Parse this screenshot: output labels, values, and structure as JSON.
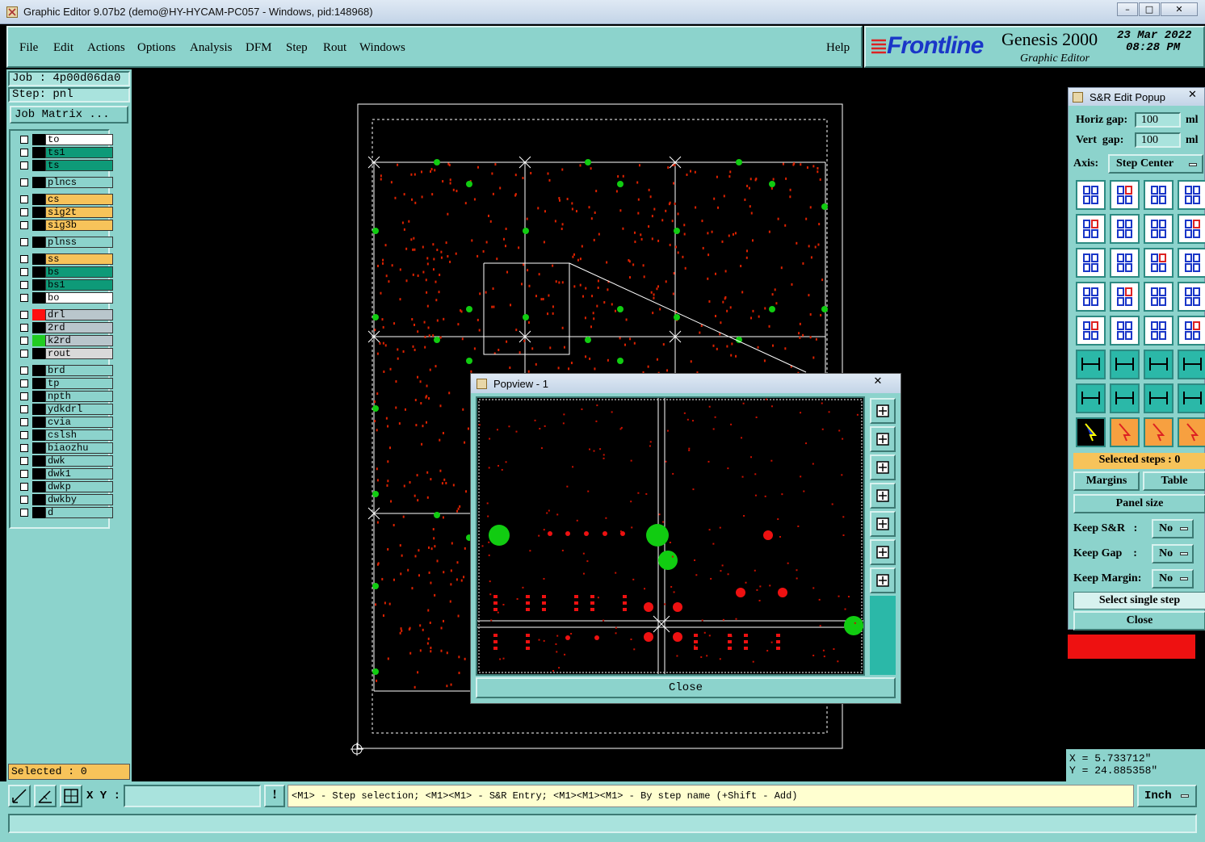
{
  "window": {
    "title": "Graphic Editor 9.07b2 (demo@HY-HYCAM-PC057 - Windows, pid:148968)"
  },
  "menu": {
    "items": [
      "File",
      "Edit",
      "Actions",
      "Options",
      "Analysis",
      "DFM",
      "Step",
      "Rout",
      "Windows"
    ],
    "help": "Help"
  },
  "logo": {
    "brand": "Frontline",
    "product": "Genesis 2000",
    "subtitle": "Graphic Editor",
    "date": "23 Mar 2022",
    "time": "08:28 PM"
  },
  "job": {
    "job_label": "Job : 4p00d06da0",
    "step_label": "Step: pnl",
    "matrix_button": "Job Matrix ..."
  },
  "layers": [
    {
      "name": "to",
      "color": "#ffffff",
      "swatch": "#000000"
    },
    {
      "name": "ts1",
      "color": "#0e9a78",
      "swatch": "#000000"
    },
    {
      "name": "ts",
      "color": "#0e9a78",
      "swatch": "#000000"
    },
    {
      "name": "plncs",
      "color": "#8cd3cc",
      "swatch": "#000000"
    },
    {
      "name": "cs",
      "color": "#f7c35a",
      "swatch": "#000000"
    },
    {
      "name": "sig2t",
      "color": "#f7c35a",
      "swatch": "#000000"
    },
    {
      "name": "sig3b",
      "color": "#f7c35a",
      "swatch": "#000000"
    },
    {
      "name": "plnss",
      "color": "#8cd3cc",
      "swatch": "#000000"
    },
    {
      "name": "ss",
      "color": "#f7c35a",
      "swatch": "#000000"
    },
    {
      "name": "bs",
      "color": "#0e9a78",
      "swatch": "#000000"
    },
    {
      "name": "bs1",
      "color": "#0e9a78",
      "swatch": "#000000"
    },
    {
      "name": "bo",
      "color": "#ffffff",
      "swatch": "#000000"
    },
    {
      "name": "drl",
      "color": "#b9c6cc",
      "swatch": "#ff1010"
    },
    {
      "name": "2rd",
      "color": "#b9c6cc",
      "swatch": "#000000"
    },
    {
      "name": "k2rd",
      "color": "#b9c6cc",
      "swatch": "#22cc22"
    },
    {
      "name": "rout",
      "color": "#d9d9d9",
      "swatch": "#000000"
    },
    {
      "name": "brd",
      "color": "#8cd3cc",
      "swatch": "#000000"
    },
    {
      "name": "tp",
      "color": "#8cd3cc",
      "swatch": "#000000"
    },
    {
      "name": "npth",
      "color": "#8cd3cc",
      "swatch": "#000000"
    },
    {
      "name": "ydkdrl",
      "color": "#8cd3cc",
      "swatch": "#000000"
    },
    {
      "name": "cvia",
      "color": "#8cd3cc",
      "swatch": "#000000"
    },
    {
      "name": "cslsh",
      "color": "#8cd3cc",
      "swatch": "#000000"
    },
    {
      "name": "biaozhu",
      "color": "#8cd3cc",
      "swatch": "#000000"
    },
    {
      "name": "dwk",
      "color": "#8cd3cc",
      "swatch": "#000000"
    },
    {
      "name": "dwk1",
      "color": "#8cd3cc",
      "swatch": "#000000"
    },
    {
      "name": "dwkp",
      "color": "#8cd3cc",
      "swatch": "#000000"
    },
    {
      "name": "dwkby",
      "color": "#8cd3cc",
      "swatch": "#000000"
    },
    {
      "name": "d",
      "color": "#8cd3cc",
      "swatch": "#000000"
    }
  ],
  "selected": "Selected : 0",
  "sr_popup": {
    "title": "S&R Edit Popup",
    "horiz_label": "Horiz gap:",
    "horiz_value": "100",
    "horiz_unit": "ml",
    "vert_label": "Vert  gap:",
    "vert_value": "100",
    "vert_unit": "ml",
    "axis_label": "Axis:",
    "axis_value": "Step Center",
    "selected_steps": "Selected steps : 0",
    "margins": "Margins",
    "table": "Table",
    "panel_size": "Panel size",
    "keep_sr_label": "Keep S&R   :",
    "keep_sr": "No",
    "keep_gap_label": "Keep Gap    :",
    "keep_gap": "No",
    "keep_margin_label": "Keep Margin:",
    "keep_margin": "No",
    "select_single": "Select single step",
    "close": "Close"
  },
  "popview": {
    "title": "Popview - 1",
    "close": "Close"
  },
  "coords": {
    "x": "X = 5.733712\"",
    "y": "Y = 24.885358\""
  },
  "statusbar": {
    "xy_label": "X Y :",
    "hint": "<M1> - Step selection; <M1><M1> - S&R Entry; <M1><M1><M1> - By step name (+Shift - Add)",
    "unit": "Inch"
  }
}
